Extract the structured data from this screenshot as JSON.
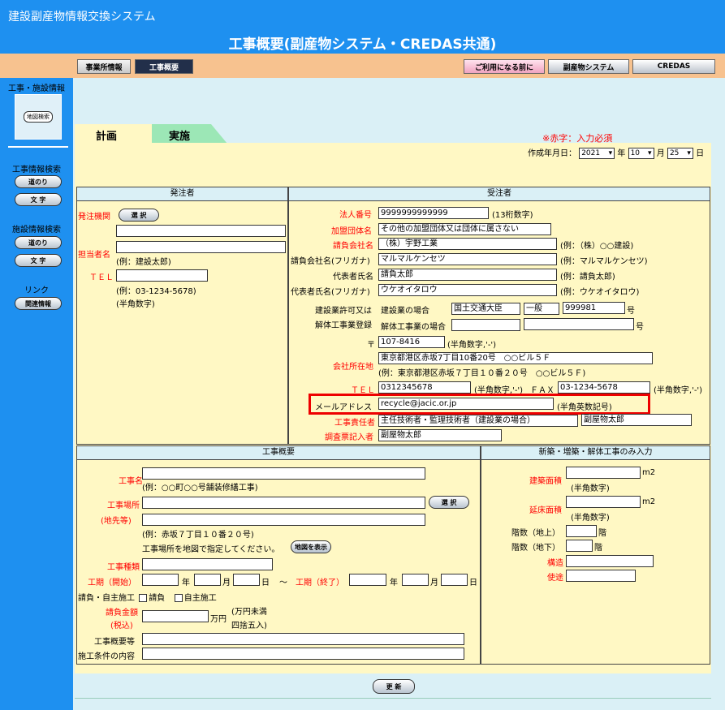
{
  "header": {
    "system_name": "建設副産物情報交換システム",
    "page_title": "工事概要(副産物システム・CREDAS共通)"
  },
  "nav": {
    "office_info": "事業所情報",
    "construction_summary": "工事概要",
    "before_use": "ご利用になる前に",
    "byproduct_system": "副産物システム",
    "credas": "CREDAS"
  },
  "sidebar": {
    "section_title": "工事・施設情報",
    "map_search": "地図検索",
    "construction_search": "工事情報検索",
    "facility_search": "施設情報検索",
    "road_btn": "道のり",
    "text_btn": "文 字",
    "link": "リンク",
    "related_btn": "関連情報"
  },
  "tabs": {
    "plan": "計画",
    "implement": "実施"
  },
  "required_note": "※赤字：入力必須",
  "created_date": {
    "label": "作成年月日：",
    "year": "2021",
    "year_unit": "年",
    "month": "10",
    "month_unit": "月",
    "day": "25",
    "day_unit": "日"
  },
  "orderer": {
    "header": "発注者",
    "agency_label": "発注機関",
    "select_btn": "選 択",
    "person_label": "担当者名",
    "person_hint": "(例：建設太郎)",
    "tel_label": "ＴＥＬ",
    "tel_hint": "(例：03-1234-5678)",
    "tel_hint2": "(半角数字)"
  },
  "contractor": {
    "header": "受注者",
    "corp_no_label": "法人番号",
    "corp_no": "9999999999999",
    "corp_no_hint": "(13桁数字)",
    "group_label": "加盟団体名",
    "group_value": "その他の加盟団体又は団体に属さない",
    "company_label": "請負会社名",
    "company_value": "（株）宇野工業",
    "company_hint": "(例：（株）○○建設)",
    "kana_label": "請負会社名(フリガナ)",
    "kana_value": "マルマルケンセツ",
    "kana_hint": "(例：マルマルケンセツ)",
    "rep_label": "代表者氏名",
    "rep_value": "請負太郎",
    "rep_hint": "(例：請負太郎)",
    "rep_kana_label": "代表者氏名(フリガナ)",
    "rep_kana_value": "ウケオイタロウ",
    "rep_kana_hint": "(例：ウケオイタロウ)",
    "license_label1": "建設業許可又は",
    "license_label2": "解体工事業登録",
    "construction_case": "建設業の場合",
    "minister": "国土交通大臣",
    "general": "一般",
    "license_no": "999981",
    "license_unit": "号",
    "demolition_case": "解体工事業の場合",
    "demolition_unit": "号",
    "zip_mark": "〒",
    "zip": "107-8416",
    "zip_hint": "(半角数字,'-')",
    "address_label": "会社所在地",
    "address_value": "東京都港区赤坂7丁目10番20号　○○ビル５Ｆ",
    "address_hint": "(例：東京都港区赤坂７丁目１０番２０号　○○ビル５Ｆ)",
    "tel_label": "ＴＥＬ",
    "tel_value": "0312345678",
    "tel_hint": "(半角数字,'-')",
    "fax_label": "ＦＡＸ",
    "fax_value": "03-1234-5678",
    "fax_hint": "(半角数字,'-')",
    "mail_label": "メールアドレス",
    "mail_value": "recycle@jacic.or.jp",
    "mail_hint": "(半角英数記号)",
    "manager_label": "工事責任者",
    "manager_type": "主任技術者・監理技術者（建設業の場合）",
    "manager_name": "副屋物太郎",
    "writer_label": "調査票記入者",
    "writer_name": "副屋物太郎"
  },
  "summary": {
    "header": "工事概要",
    "name_label": "工事名",
    "name_hint": "(例：○○町○○号舗装修繕工事)",
    "place_label": "工事場所",
    "place_label2": "(地先等)",
    "select_btn": "選 択",
    "place_hint": "(例：赤坂７丁目１０番２０号)",
    "map_note": "工事場所を地図で指定してください。",
    "map_btn": "地図を表示",
    "type_label": "工事種類",
    "start_label": "工期（開始）",
    "end_label": "工期（終了）",
    "year": "年",
    "month": "月",
    "day": "日",
    "tilde": "～",
    "self_label": "請負・自主施工",
    "contract_opt": "請負",
    "self_opt": "自主施工",
    "amount_label": "請負金額",
    "amount_label2": "(税込)",
    "amount_unit": "万円",
    "amount_hint1": "(万円未満",
    "amount_hint2": "四捨五入)",
    "detail_label": "工事概要等",
    "condition_label": "施工条件の内容"
  },
  "newbuild": {
    "header": "新築・増築・解体工事のみ入力",
    "build_area": "建築面積",
    "floor_area": "延床面積",
    "m2": "m2",
    "num_hint": "(半角数字)",
    "floors_up": "階数（地上）",
    "floors_down": "階数（地下）",
    "floor_unit": "階",
    "structure": "構造",
    "use": "使途"
  },
  "update_btn": "更 新"
}
